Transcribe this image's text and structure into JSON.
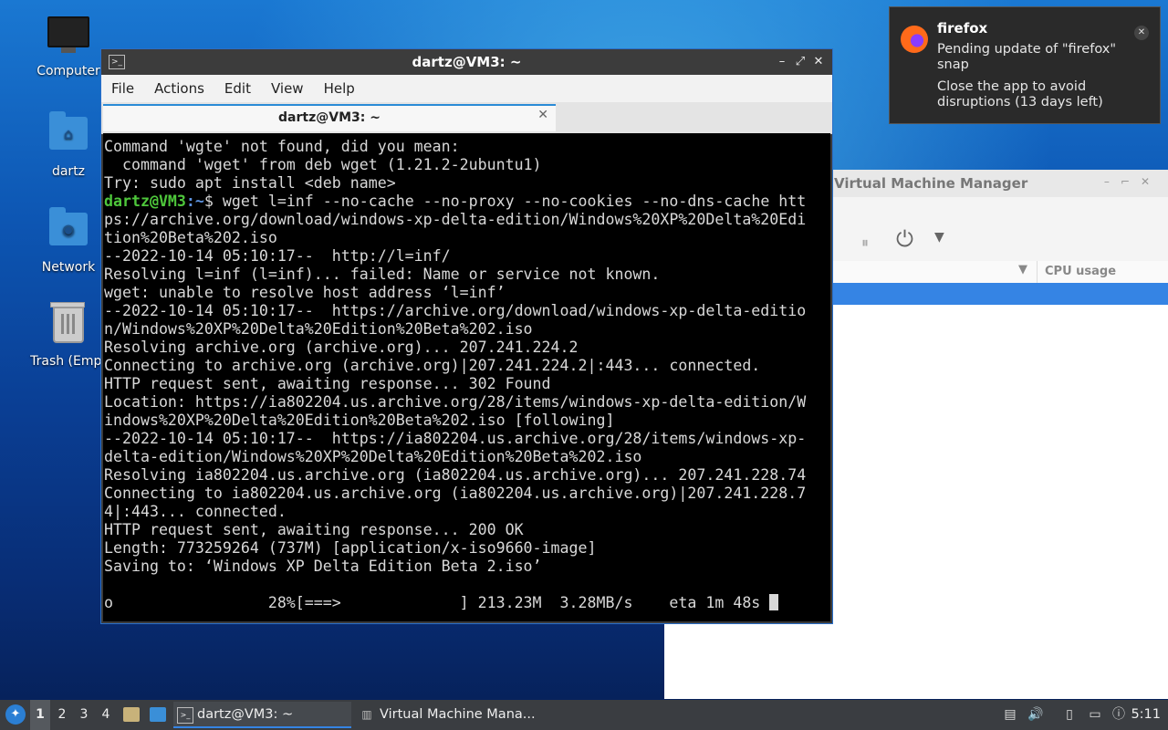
{
  "desktop": {
    "icons": [
      {
        "label": "Computer"
      },
      {
        "label": "dartz"
      },
      {
        "label": "Network"
      },
      {
        "label": "Trash (Empt"
      }
    ]
  },
  "vmm": {
    "title": "Virtual Machine Manager",
    "column_cpu": "CPU usage"
  },
  "terminal": {
    "title": "dartz@VM3: ~",
    "menu": [
      "File",
      "Actions",
      "Edit",
      "View",
      "Help"
    ],
    "tab_label": "dartz@VM3: ~",
    "lines": [
      "Command 'wgte' not found, did you mean:",
      "  command 'wget' from deb wget (1.21.2-2ubuntu1)",
      "Try: sudo apt install <deb name>",
      "__PROMPT__",
      "ps://archive.org/download/windows-xp-delta-edition/Windows%20XP%20Delta%20Edi",
      "tion%20Beta%202.iso",
      "--2022-10-14 05:10:17--  http://l=inf/",
      "Resolving l=inf (l=inf)... failed: Name or service not known.",
      "wget: unable to resolve host address ‘l=inf’",
      "--2022-10-14 05:10:17--  https://archive.org/download/windows-xp-delta-editio",
      "n/Windows%20XP%20Delta%20Edition%20Beta%202.iso",
      "Resolving archive.org (archive.org)... 207.241.224.2",
      "Connecting to archive.org (archive.org)|207.241.224.2|:443... connected.",
      "HTTP request sent, awaiting response... 302 Found",
      "Location: https://ia802204.us.archive.org/28/items/windows-xp-delta-edition/W",
      "indows%20XP%20Delta%20Edition%20Beta%202.iso [following]",
      "--2022-10-14 05:10:17--  https://ia802204.us.archive.org/28/items/windows-xp-",
      "delta-edition/Windows%20XP%20Delta%20Edition%20Beta%202.iso",
      "Resolving ia802204.us.archive.org (ia802204.us.archive.org)... 207.241.228.74",
      "Connecting to ia802204.us.archive.org (ia802204.us.archive.org)|207.241.228.7",
      "4|:443... connected.",
      "HTTP request sent, awaiting response... 200 OK",
      "Length: 773259264 (737M) [application/x-iso9660-image]",
      "Saving to: ‘Windows XP Delta Edition Beta 2.iso’",
      "",
      "o                 28%[===>             ] 213.23M  3.28MB/s    eta 1m 48s "
    ],
    "prompt_user": "dartz@VM3",
    "prompt_path": ":~",
    "prompt_cmd": "$ wget l=inf --no-cache --no-proxy --no-cookies --no-dns-cache htt"
  },
  "notification": {
    "app": "firefox",
    "line1": "Pending update of \"firefox\" snap",
    "line2": "Close the app to avoid disruptions (13 days left)"
  },
  "taskbar": {
    "workspaces": [
      "1",
      "2",
      "3",
      "4"
    ],
    "tasks": [
      {
        "label": "dartz@VM3: ~"
      },
      {
        "label": "Virtual Machine Mana..."
      }
    ],
    "clock": "5:11"
  }
}
